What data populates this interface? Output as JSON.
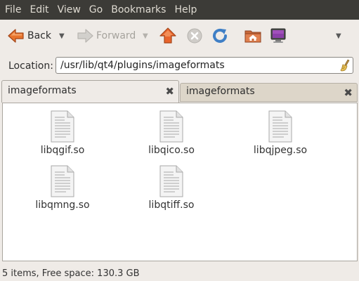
{
  "menubar": {
    "items": [
      "File",
      "Edit",
      "View",
      "Go",
      "Bookmarks",
      "Help"
    ]
  },
  "toolbar": {
    "back_label": "Back",
    "forward_label": "Forward",
    "icons": [
      "back-arrow-icon",
      "forward-arrow-icon",
      "up-arrow-icon",
      "stop-icon",
      "reload-icon",
      "home-folder-icon",
      "computer-icon"
    ]
  },
  "location": {
    "label": "Location:",
    "value": "/usr/lib/qt4/plugins/imageformats"
  },
  "tabs": [
    {
      "label": "imageformats",
      "active": true
    },
    {
      "label": "imageformats",
      "active": false
    }
  ],
  "files": [
    {
      "name": "libqgif.so"
    },
    {
      "name": "libqico.so"
    },
    {
      "name": "libqjpeg.so"
    },
    {
      "name": "libqmng.so"
    },
    {
      "name": "libqtiff.so"
    }
  ],
  "status": {
    "text": "5 items, Free space: 130.3 GB"
  },
  "colors": {
    "menubar_bg": "#3c3b37",
    "window_bg": "#efebe7",
    "accent_orange": "#e8642c",
    "reload_blue": "#3f7fc6"
  }
}
